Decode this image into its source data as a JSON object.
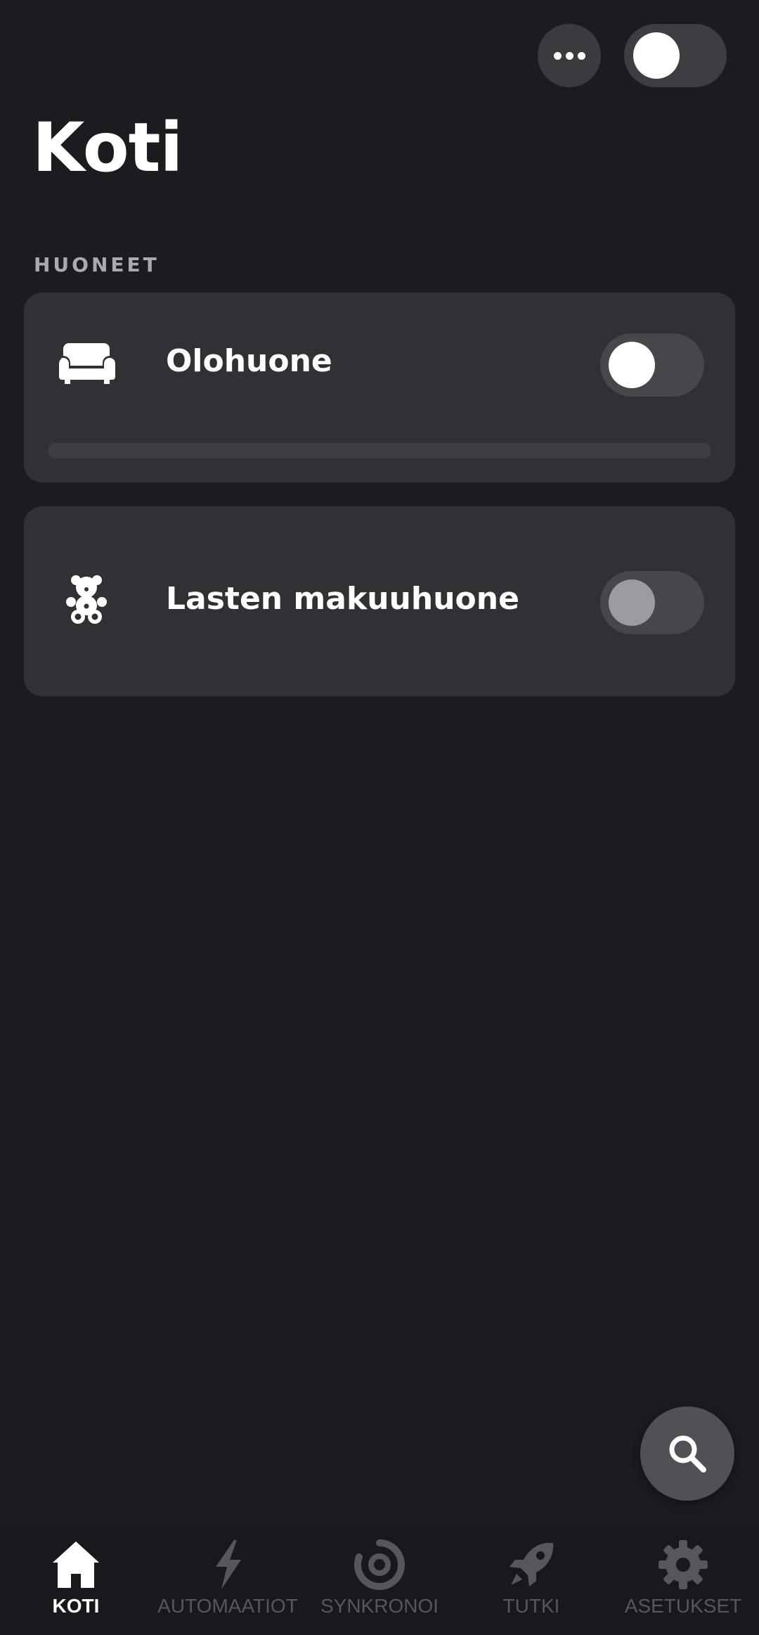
{
  "header": {
    "title": "Koti"
  },
  "rooms": {
    "section_label": "HUONEET",
    "items": [
      {
        "name": "Olohuone",
        "icon": "sofa-icon",
        "on": true,
        "brightness": 0
      },
      {
        "name": "Lasten makuuhuone",
        "icon": "teddy-bear-icon",
        "on": false
      }
    ]
  },
  "nav": {
    "items": [
      {
        "label": "KOTI",
        "icon": "home-icon",
        "active": true
      },
      {
        "label": "AUTOMAATIOT",
        "icon": "lightning-icon",
        "active": false
      },
      {
        "label": "SYNKRONOI",
        "icon": "sync-icon",
        "active": false
      },
      {
        "label": "TUTKI",
        "icon": "rocket-icon",
        "active": false
      },
      {
        "label": "ASETUKSET",
        "icon": "gear-icon",
        "active": false
      }
    ]
  },
  "colors": {
    "background": "#1a1c20",
    "card": "#303135",
    "active": "#ffffff",
    "inactive": "#55575c"
  }
}
